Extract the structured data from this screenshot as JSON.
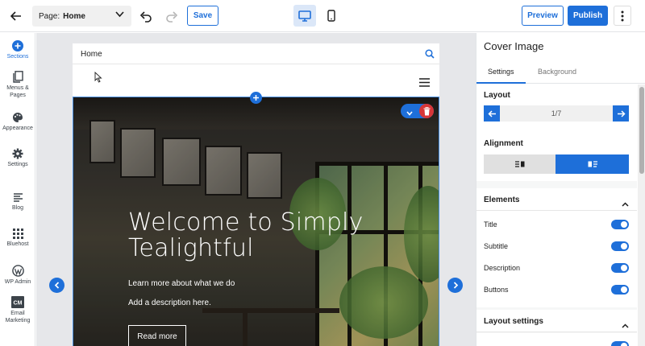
{
  "topbar": {
    "page_label": "Page:",
    "page_value": "Home",
    "save_label": "Save",
    "preview_label": "Preview",
    "publish_label": "Publish"
  },
  "sidebar": {
    "items": [
      {
        "label": "Sections",
        "icon": "plus-circle-icon",
        "active": true
      },
      {
        "label": "Menus & Pages",
        "icon": "pages-icon"
      },
      {
        "label": "Appearance",
        "icon": "palette-icon"
      },
      {
        "label": "Settings",
        "icon": "gear-icon"
      },
      {
        "label": "Blog",
        "icon": "blog-icon"
      },
      {
        "label": "Bluehost",
        "icon": "grid-icon"
      },
      {
        "label": "WP Admin",
        "icon": "wordpress-icon"
      },
      {
        "label": "Email Marketing",
        "icon": "cm-icon"
      }
    ]
  },
  "site": {
    "nav_home": "Home",
    "cover": {
      "title": "Welcome to Simply Tealightful",
      "subtitle": "Learn more about what we do",
      "description": "Add a description here.",
      "button": "Read more"
    }
  },
  "panel": {
    "title": "Cover Image",
    "tabs": [
      "Settings",
      "Background"
    ],
    "active_tab": "Settings",
    "layout": {
      "label": "Layout",
      "count": "1/7"
    },
    "alignment": {
      "label": "Alignment",
      "selected": "right"
    },
    "elements": {
      "label": "Elements",
      "items": [
        {
          "label": "Title",
          "on": true
        },
        {
          "label": "Subtitle",
          "on": true
        },
        {
          "label": "Description",
          "on": true
        },
        {
          "label": "Buttons",
          "on": true
        }
      ]
    },
    "layout_settings": {
      "label": "Layout settings"
    }
  },
  "colors": {
    "accent": "#1e6fd9",
    "delete": "#d63638",
    "canvas_bg": "#e6e7ea"
  }
}
